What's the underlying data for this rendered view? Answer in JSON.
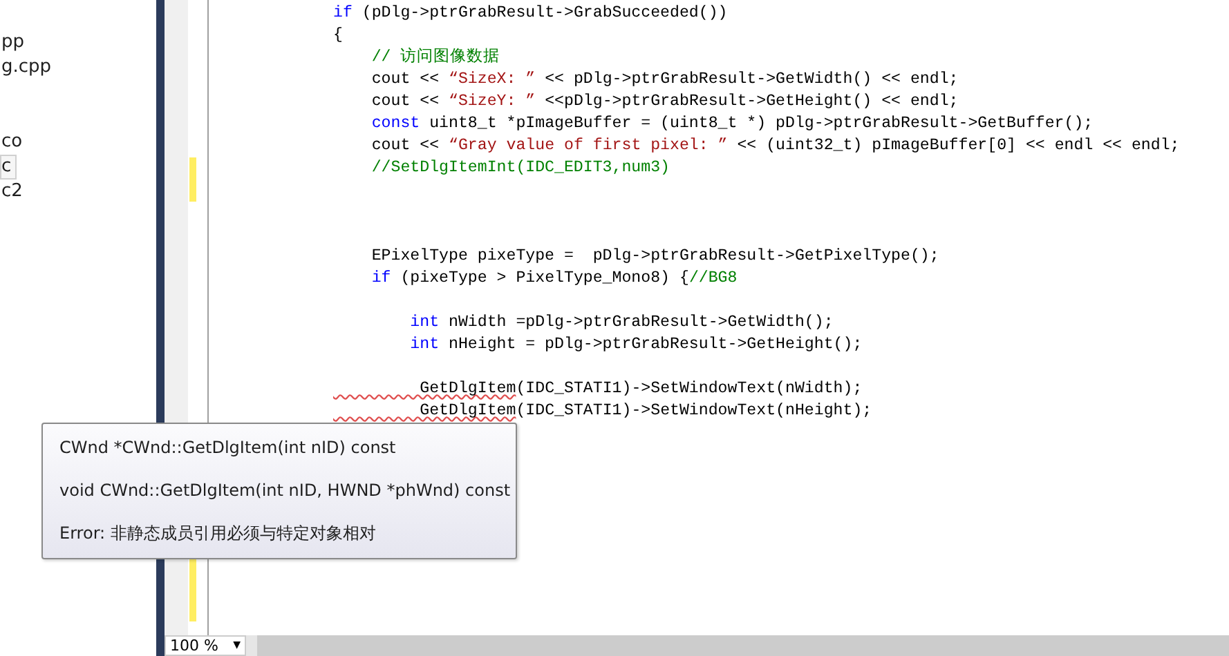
{
  "solution_explorer": {
    "items": [
      {
        "label": "pp",
        "selected": false
      },
      {
        "label": "g.cpp",
        "selected": false
      },
      {
        "label": "co",
        "selected": false
      },
      {
        "label": "c",
        "selected": true
      },
      {
        "label": "c2",
        "selected": false
      }
    ]
  },
  "editor": {
    "lines": [
      {
        "changed": false,
        "tokens": [
          {
            "text": "if",
            "kind": "keyword"
          },
          {
            "text": " (pDlg->ptrGrabResult->GrabSucceeded())",
            "kind": "plain"
          }
        ]
      },
      {
        "changed": false,
        "tokens": [
          {
            "text": "{",
            "kind": "plain"
          }
        ]
      },
      {
        "changed": false,
        "tokens": [
          {
            "text": "    // 访问图像数据",
            "kind": "comment"
          }
        ]
      },
      {
        "changed": false,
        "tokens": [
          {
            "text": "    cout << ",
            "kind": "plain"
          },
          {
            "text": "“SizeX: ”",
            "kind": "string"
          },
          {
            "text": " << pDlg->ptrGrabResult->GetWidth() << endl;",
            "kind": "plain"
          }
        ]
      },
      {
        "changed": false,
        "tokens": [
          {
            "text": "    cout << ",
            "kind": "plain"
          },
          {
            "text": "“SizeY: ”",
            "kind": "string"
          },
          {
            "text": " <<pDlg->ptrGrabResult->GetHeight() << endl;",
            "kind": "plain"
          }
        ]
      },
      {
        "changed": false,
        "tokens": [
          {
            "text": "    const",
            "kind": "keyword"
          },
          {
            "text": " uint8_t *pImageBuffer = (uint8_t *) pDlg->ptrGrabResult->GetBuffer();",
            "kind": "plain"
          }
        ]
      },
      {
        "changed": false,
        "tokens": [
          {
            "text": "    cout << ",
            "kind": "plain"
          },
          {
            "text": "“Gray value of first pixel: ”",
            "kind": "string"
          },
          {
            "text": " << (uint32_t) pImageBuffer[0] << endl << endl;",
            "kind": "plain"
          }
        ]
      },
      {
        "changed": true,
        "tokens": [
          {
            "text": "    //SetDlgItemInt(IDC_EDIT3,num3)",
            "kind": "comment"
          }
        ]
      },
      {
        "changed": true
      },
      {
        "changed": false
      },
      {
        "changed": false
      },
      {
        "changed": false,
        "tokens": [
          {
            "text": "    EPixelType pixeType =  pDlg->ptrGrabResult->GetPixelType();",
            "kind": "plain"
          }
        ]
      },
      {
        "changed": false,
        "tokens": [
          {
            "text": "    if",
            "kind": "keyword"
          },
          {
            "text": " (pixeType > PixelType_Mono8) {",
            "kind": "plain"
          },
          {
            "text": "//BG8",
            "kind": "comment"
          }
        ]
      },
      {
        "changed": false
      },
      {
        "changed": false,
        "tokens": [
          {
            "text": "        int",
            "kind": "keyword"
          },
          {
            "text": " nWidth =pDlg->ptrGrabResult->GetWidth();",
            "kind": "plain"
          }
        ]
      },
      {
        "changed": false,
        "tokens": [
          {
            "text": "        int",
            "kind": "keyword"
          },
          {
            "text": " nHeight = pDlg->ptrGrabResult->GetHeight();",
            "kind": "plain"
          }
        ]
      },
      {
        "changed": false
      },
      {
        "changed": false,
        "tokens": [
          {
            "text": "         GetDlgItem",
            "kind": "error"
          },
          {
            "text": "(IDC_STATI1)->SetWindowText(nWidth);",
            "kind": "plain"
          }
        ]
      },
      {
        "changed": false,
        "tokens": [
          {
            "text": "         GetDlgItem",
            "kind": "error"
          },
          {
            "text": "(IDC_STATI1)->SetWindowText(nHeight);",
            "kind": "plain"
          }
        ]
      },
      {
        "changed": false
      },
      {
        "changed": false
      },
      {
        "changed": false
      },
      {
        "changed": false
      },
      {
        "changed": false
      },
      {
        "changed": false
      },
      {
        "changed": true
      },
      {
        "changed": true
      },
      {
        "changed": true
      }
    ]
  },
  "tooltip": {
    "lines": [
      "CWnd *CWnd::GetDlgItem(int nID) const",
      "void CWnd::GetDlgItem(int nID, HWND *phWnd) const",
      "Error: 非静态成员引用必须与特定对象相对"
    ]
  },
  "status_bar": {
    "zoom": "100 %",
    "dropdown_arrow": "▼"
  }
}
